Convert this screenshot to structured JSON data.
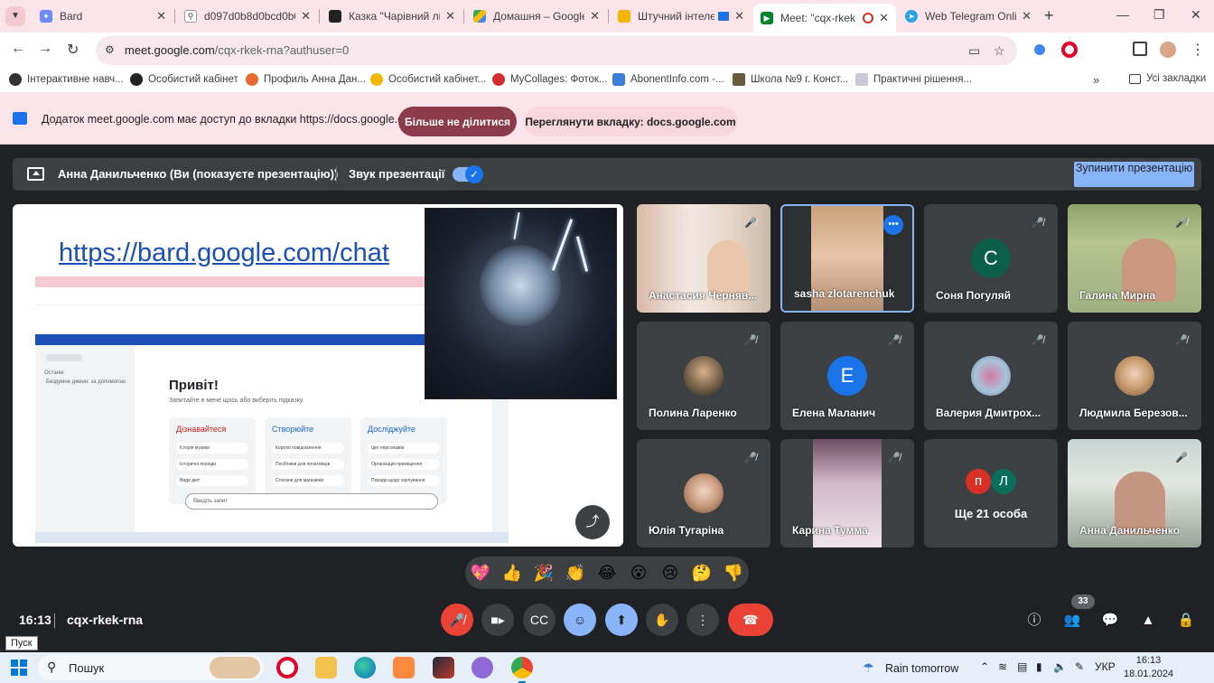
{
  "browser": {
    "tabs": [
      {
        "label": "Bard",
        "active": false
      },
      {
        "label": "d097d0b8d0bcd0b0",
        "active": false
      },
      {
        "label": "Казка \"Чарівний ліс",
        "active": false
      },
      {
        "label": "Домашня – Google",
        "active": false
      },
      {
        "label": "Штучний інтеле",
        "active": false
      },
      {
        "label": "Meet: \"cqx-rkek",
        "active": true
      },
      {
        "label": "Web Telegram Onlin",
        "active": false
      }
    ],
    "url_host": "meet.google.com",
    "url_path": "/cqx-rkek-rna?authuser=0",
    "bookmarks": [
      "Інтерактивне навч...",
      "Особистий кабінет",
      "Профиль Анна Дан...",
      "Особистий кабінет...",
      "MyCollages: Фоток...",
      "AbonentInfo.com -...",
      "Школа №9 г. Конст...",
      "Практичні рішення..."
    ],
    "all_bookmarks": "Усі закладки",
    "infobar_message": "Додаток meet.google.com має доступ до вкладки https://docs.google.com",
    "stop_sharing_label": "Більше не ділитися",
    "view_tab_label": "Переглянути вкладку: docs.google.com"
  },
  "meet": {
    "presenter_text": "Анна Данильченко (Ви (показуєте презентацію))",
    "audio_label": "Звук презентації",
    "stop_presenting_label": "Зупинити презентацію",
    "slide": {
      "link_text": "https://bard.google.com/chat",
      "bard_greeting": "Привіт!",
      "bard_subtitle": "Запитайте в мене щось або виберіть підказку.",
      "columns": [
        {
          "title": "Дізнавайтеся",
          "items": [
            "Історія музики",
            "Історичні періоди",
            "Види діет"
          ]
        },
        {
          "title": "Створюйте",
          "items": [
            "Короткі повідомлення",
            "Посібники для початківців",
            "Слогани для магазинів"
          ]
        },
        {
          "title": "Досліджуйте",
          "items": [
            "Ідеї персонажів",
            "Організація приміщення",
            "Поради щодо харчування"
          ]
        }
      ],
      "prompt_placeholder": "Введіть запит",
      "sidebar_label": "Останні",
      "sidebar_item": "Бездумне джинн: за допомогою"
    },
    "participants": [
      {
        "name": "Анастасия Черняв...",
        "type": "video"
      },
      {
        "name": "sasha zlotarenchuk",
        "type": "video"
      },
      {
        "name": "Соня Погуляй",
        "type": "letter",
        "letter": "С",
        "color": "#0b5e4a"
      },
      {
        "name": "Галина Мирна",
        "type": "video"
      },
      {
        "name": "Полина Ларенко",
        "type": "photo"
      },
      {
        "name": "Елена Маланич",
        "type": "letter",
        "letter": "E",
        "color": "#1a73e8"
      },
      {
        "name": "Валерия Дмитрох...",
        "type": "photo"
      },
      {
        "name": "Людмила Березов...",
        "type": "photo"
      },
      {
        "name": "Юлія Тугаріна",
        "type": "photo"
      },
      {
        "name": "Карина Тумма",
        "type": "video"
      },
      {
        "name": "Ще 21 особа",
        "type": "more",
        "letters": [
          "п",
          "Л"
        ]
      },
      {
        "name": "Анна Данильченко",
        "type": "video"
      }
    ],
    "reactions": [
      "💖",
      "👍",
      "🎉",
      "👏",
      "😂",
      "😮",
      "😢",
      "🤔",
      "👎"
    ],
    "time": "16:13",
    "meeting_code": "cqx-rkek-rna",
    "people_count": "33"
  },
  "tooltip": "Пуск",
  "taskbar": {
    "search_placeholder": "Пошук",
    "weather": "Rain tomorrow",
    "language": "УКР",
    "time": "16:13",
    "date": "18.01.2024"
  }
}
